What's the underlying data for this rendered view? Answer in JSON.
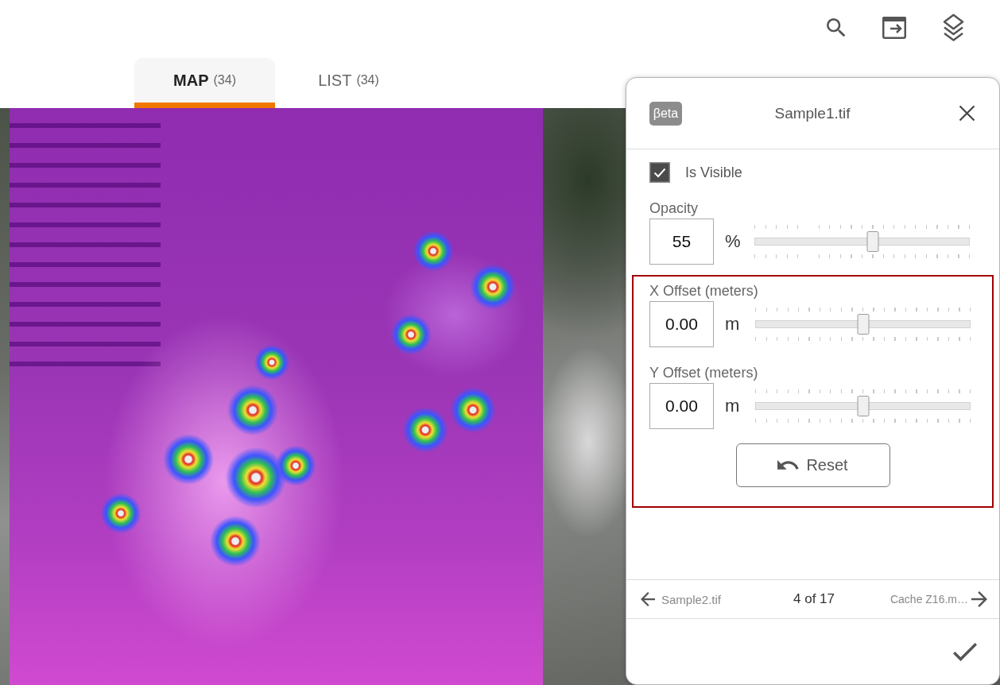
{
  "tabs": [
    {
      "label": "MAP",
      "count": "(34)",
      "selected": true
    },
    {
      "label": "LIST",
      "count": "(34)",
      "selected": false
    }
  ],
  "layer_panel": {
    "badge": "βeta",
    "title": "Sample1.tif",
    "visibility": {
      "label": "Is Visible",
      "checked": true
    },
    "opacity": {
      "label": "Opacity",
      "value": "55",
      "unit": "%",
      "level": 0.55
    },
    "offsets": {
      "highlighted": true,
      "fields": [
        {
          "label": "X Offset (meters)",
          "value": "0.00",
          "unit": "m",
          "level": 0.5
        },
        {
          "label": "Y Offset (meters)",
          "value": "0.00",
          "unit": "m",
          "level": 0.5
        }
      ],
      "reset_button": "Reset"
    },
    "navigation": {
      "previous": "Sample2.tif",
      "position": "4 of 17",
      "next": "Cache Z16.m…"
    }
  }
}
